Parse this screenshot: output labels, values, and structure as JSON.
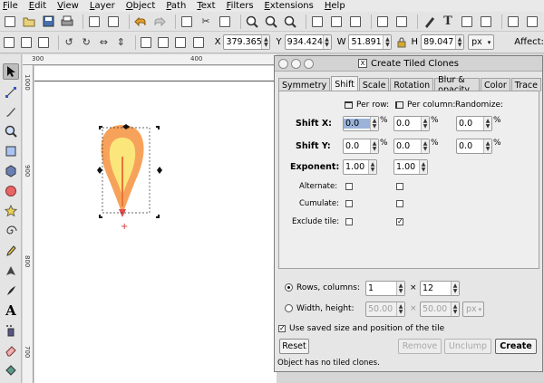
{
  "menu": [
    "File",
    "Edit",
    "View",
    "Layer",
    "Object",
    "Path",
    "Text",
    "Filters",
    "Extensions",
    "Help"
  ],
  "coords": {
    "x_label": "X",
    "x_value": "379.365",
    "y_label": "Y",
    "y_value": "934.424",
    "w_label": "W",
    "w_value": "51.891",
    "h_label": "H",
    "h_value": "89.047",
    "unit": "px",
    "affect_label": "Affect:"
  },
  "ruler": {
    "h_ticks": [
      "300",
      "400"
    ],
    "v_ticks": [
      "1000",
      "900",
      "800",
      "700"
    ]
  },
  "dialog": {
    "title": "Create Tiled Clones",
    "tabs": [
      "Symmetry",
      "Shift",
      "Scale",
      "Rotation",
      "Blur & opacity",
      "Color",
      "Trace"
    ],
    "active_tab": "Shift",
    "col_per_row": "Per row:",
    "col_per_column": "Per column:",
    "col_randomize": "Randomize:",
    "shift_x_label": "Shift X:",
    "shift_y_label": "Shift Y:",
    "exponent_label": "Exponent:",
    "alternate_label": "Alternate:",
    "cumulate_label": "Cumulate:",
    "exclude_tile_label": "Exclude tile:",
    "pct": "%",
    "shift_x": {
      "per_row": "0.0",
      "per_column": "0.0",
      "randomize": "0.0"
    },
    "shift_y": {
      "per_row": "0.0",
      "per_column": "0.0",
      "randomize": "0.0"
    },
    "exponent": {
      "per_row": "1.00",
      "per_column": "1.00"
    },
    "exclude_tile": {
      "per_row": false,
      "per_column": true
    },
    "rows_columns_label": "Rows, columns:",
    "rows": "1",
    "times": "×",
    "columns": "12",
    "width_height_label": "Width, height:",
    "width": "50.00",
    "height": "50.00",
    "size_unit": "px",
    "use_saved_label": "Use saved size and position of the tile",
    "reset_label": "Reset",
    "remove_label": "Remove",
    "unclump_label": "Unclump",
    "create_label": "Create",
    "status": "Object has no tiled clones."
  }
}
